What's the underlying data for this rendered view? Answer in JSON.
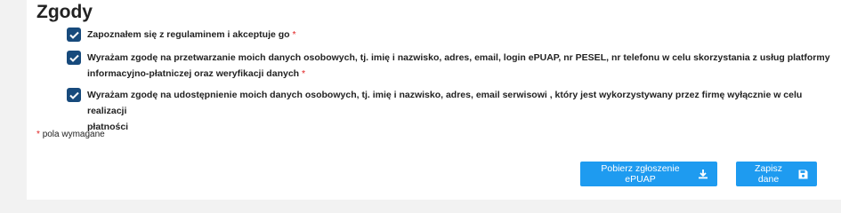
{
  "section": {
    "title": "Zgody"
  },
  "consents": [
    {
      "text": "Zapoznałem się z regulaminem i akceptuje go",
      "required_mark": "*",
      "checked": true
    },
    {
      "text_line1": "Wyrażam zgodę na przetwarzanie moich danych osobowych, tj. imię i nazwisko, adres, email, login ePUAP, nr PESEL, nr telefonu w celu skorzystania z usług platformy",
      "text_line2": "informacyjno-płatniczej oraz weryfikacji danych",
      "required_mark": "*",
      "checked": true
    },
    {
      "text_line1": "Wyrażam zgodę na udostępnienie moich danych osobowych, tj. imię i nazwisko, adres, email serwisowi , który jest wykorzystywany przez firmę wyłącznie w celu realizacji",
      "text_line2": "płatności",
      "checked": true
    }
  ],
  "required_note": {
    "mark": "*",
    "text": "pola wymagane"
  },
  "buttons": {
    "download_label": "Pobierz zgłoszenie ePUAP",
    "save_label": "Zapisz dane"
  },
  "colors": {
    "primary": "#1e9bf0",
    "checkbox": "#174a7c",
    "required": "#e02020"
  },
  "icons": {
    "download": "download-icon",
    "save": "floppy-disk-icon",
    "check": "check-icon"
  }
}
